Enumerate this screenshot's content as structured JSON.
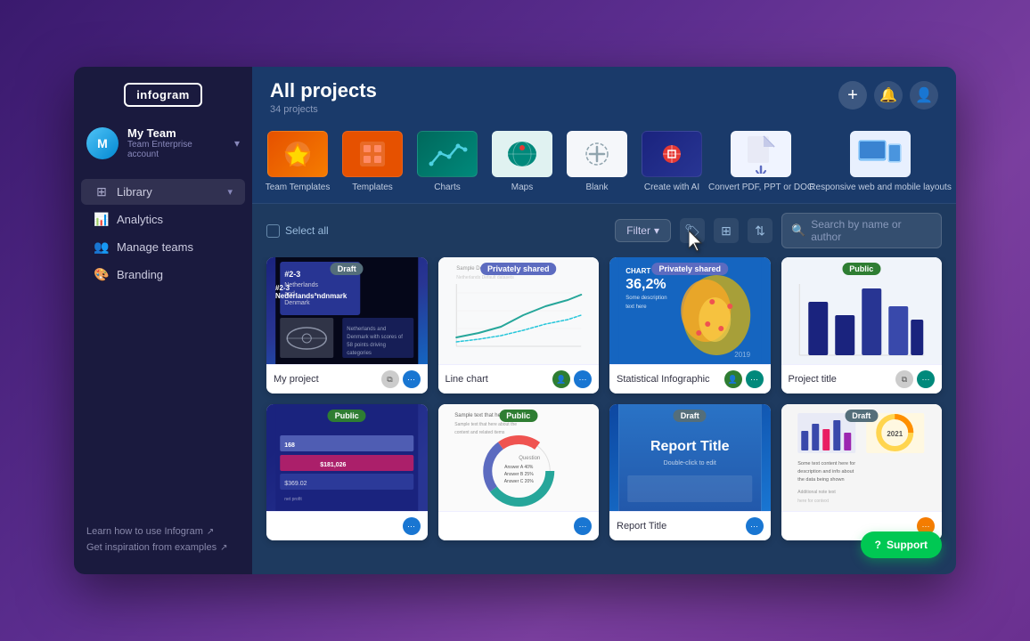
{
  "app": {
    "logo": "infogram",
    "window_title": "All projects",
    "project_count": "34 projects"
  },
  "sidebar": {
    "team_name": "My Team",
    "team_sub": "Team Enterprise account",
    "nav_items": [
      {
        "id": "library",
        "label": "Library",
        "has_chevron": true
      },
      {
        "id": "analytics",
        "label": "Analytics"
      },
      {
        "id": "manage-teams",
        "label": "Manage teams"
      },
      {
        "id": "branding",
        "label": "Branding"
      }
    ],
    "footer_links": [
      {
        "id": "learn",
        "label": "Learn how to use Infogram"
      },
      {
        "id": "inspire",
        "label": "Get inspiration from examples"
      }
    ]
  },
  "template_bar": {
    "items": [
      {
        "id": "team-templates",
        "label": "Team Templates",
        "icon": "⭐",
        "bg": "orange"
      },
      {
        "id": "templates",
        "label": "Templates",
        "icon": "📋",
        "bg": "orange2"
      },
      {
        "id": "charts",
        "label": "Charts",
        "icon": "📈",
        "bg": "teal"
      },
      {
        "id": "maps",
        "label": "Maps",
        "icon": "🌍",
        "bg": "teal2"
      },
      {
        "id": "blank",
        "label": "Blank",
        "icon": "+",
        "bg": "add"
      },
      {
        "id": "create-ai",
        "label": "Create with AI",
        "icon": "✦",
        "bg": "dark"
      },
      {
        "id": "convert-pdf",
        "label": "Convert PDF, PPT or DOC",
        "icon": "↑",
        "bg": "light"
      },
      {
        "id": "responsive",
        "label": "Responsive web and mobile layouts",
        "icon": "📱",
        "bg": "device"
      }
    ]
  },
  "toolbar": {
    "select_all_label": "Select all",
    "filter_label": "Filter",
    "search_placeholder": "Search by name or author"
  },
  "projects": {
    "row1": [
      {
        "id": "my-project",
        "title": "My project",
        "badge": "Draft",
        "badge_type": "draft"
      },
      {
        "id": "line-chart",
        "title": "Line chart",
        "badge": "Privately shared",
        "badge_type": "private"
      },
      {
        "id": "statistical-infographic",
        "title": "Statistical Infographic",
        "badge": "Privately shared",
        "badge_type": "private"
      },
      {
        "id": "project-title",
        "title": "Project title",
        "badge": "Public",
        "badge_type": "public"
      }
    ],
    "row2": [
      {
        "id": "public-1",
        "title": "",
        "badge": "Public",
        "badge_type": "public"
      },
      {
        "id": "public-2",
        "title": "",
        "badge": "Public",
        "badge_type": "public"
      },
      {
        "id": "report-title",
        "title": "Report Title",
        "badge": "Draft",
        "badge_type": "draft"
      },
      {
        "id": "draft-1",
        "title": "",
        "badge": "Draft",
        "badge_type": "draft"
      }
    ]
  },
  "support": {
    "label": "Support"
  }
}
